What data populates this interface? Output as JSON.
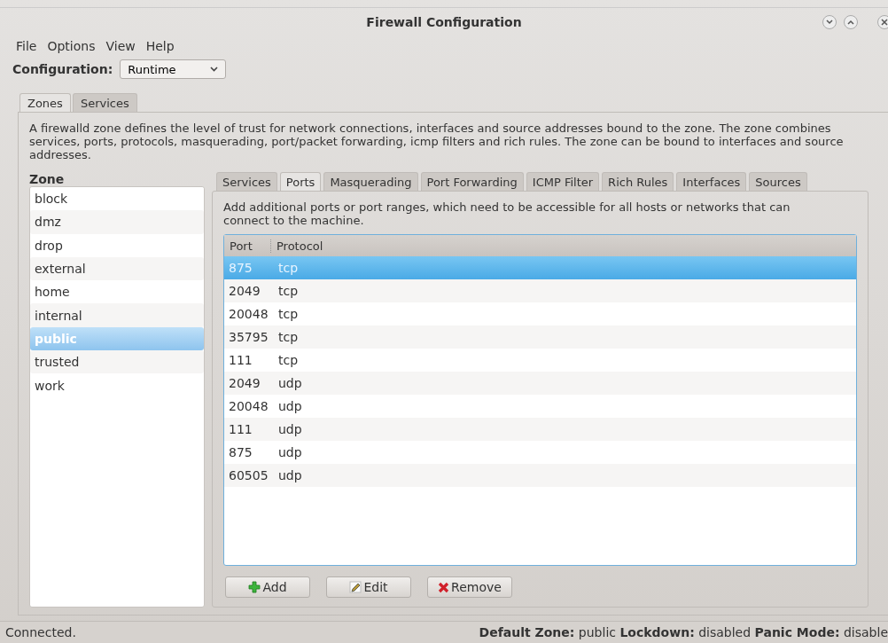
{
  "window": {
    "title": "Firewall Configuration"
  },
  "menu": [
    "File",
    "Options",
    "View",
    "Help"
  ],
  "configuration": {
    "label": "Configuration:",
    "value": "Runtime"
  },
  "main_tabs": [
    {
      "label": "Zones",
      "selected": true
    },
    {
      "label": "Services",
      "selected": false
    }
  ],
  "description": "A firewalld zone defines the level of trust for network connections, interfaces and source addresses bound to the zone. The zone combines services, ports, protocols, masquerading, port/packet forwarding, icmp filters and rich rules. The zone can be bound to interfaces and source addresses.",
  "zone_heading": "Zone",
  "zones": [
    {
      "label": "block",
      "selected": false
    },
    {
      "label": "dmz",
      "selected": false
    },
    {
      "label": "drop",
      "selected": false
    },
    {
      "label": "external",
      "selected": false
    },
    {
      "label": "home",
      "selected": false
    },
    {
      "label": "internal",
      "selected": false
    },
    {
      "label": "public",
      "selected": true
    },
    {
      "label": "trusted",
      "selected": false
    },
    {
      "label": "work",
      "selected": false
    }
  ],
  "zone_tabs": [
    {
      "label": "Services",
      "selected": false
    },
    {
      "label": "Ports",
      "selected": true
    },
    {
      "label": "Masquerading",
      "selected": false
    },
    {
      "label": "Port Forwarding",
      "selected": false
    },
    {
      "label": "ICMP Filter",
      "selected": false
    },
    {
      "label": "Rich Rules",
      "selected": false
    },
    {
      "label": "Interfaces",
      "selected": false
    },
    {
      "label": "Sources",
      "selected": false
    }
  ],
  "ports_hint": "Add additional ports or port ranges, which need to be accessible for all hosts or networks that can connect to the machine.",
  "table": {
    "columns": [
      "Port",
      "Protocol"
    ],
    "rows": [
      {
        "port": "875",
        "protocol": "tcp",
        "selected": true
      },
      {
        "port": "2049",
        "protocol": "tcp",
        "selected": false
      },
      {
        "port": "20048",
        "protocol": "tcp",
        "selected": false
      },
      {
        "port": "35795",
        "protocol": "tcp",
        "selected": false
      },
      {
        "port": "111",
        "protocol": "tcp",
        "selected": false
      },
      {
        "port": "2049",
        "protocol": "udp",
        "selected": false
      },
      {
        "port": "20048",
        "protocol": "udp",
        "selected": false
      },
      {
        "port": "111",
        "protocol": "udp",
        "selected": false
      },
      {
        "port": "875",
        "protocol": "udp",
        "selected": false
      },
      {
        "port": "60505",
        "protocol": "udp",
        "selected": false
      }
    ]
  },
  "buttons": [
    {
      "kind": "add",
      "label": "Add"
    },
    {
      "kind": "edit",
      "label": "Edit"
    },
    {
      "kind": "remove",
      "label": "Remove"
    }
  ],
  "status_bar": {
    "message": "Connected.",
    "details": "**Default Zone:** public **Lockdown:** disabled **Panic Mode:** disable"
  }
}
